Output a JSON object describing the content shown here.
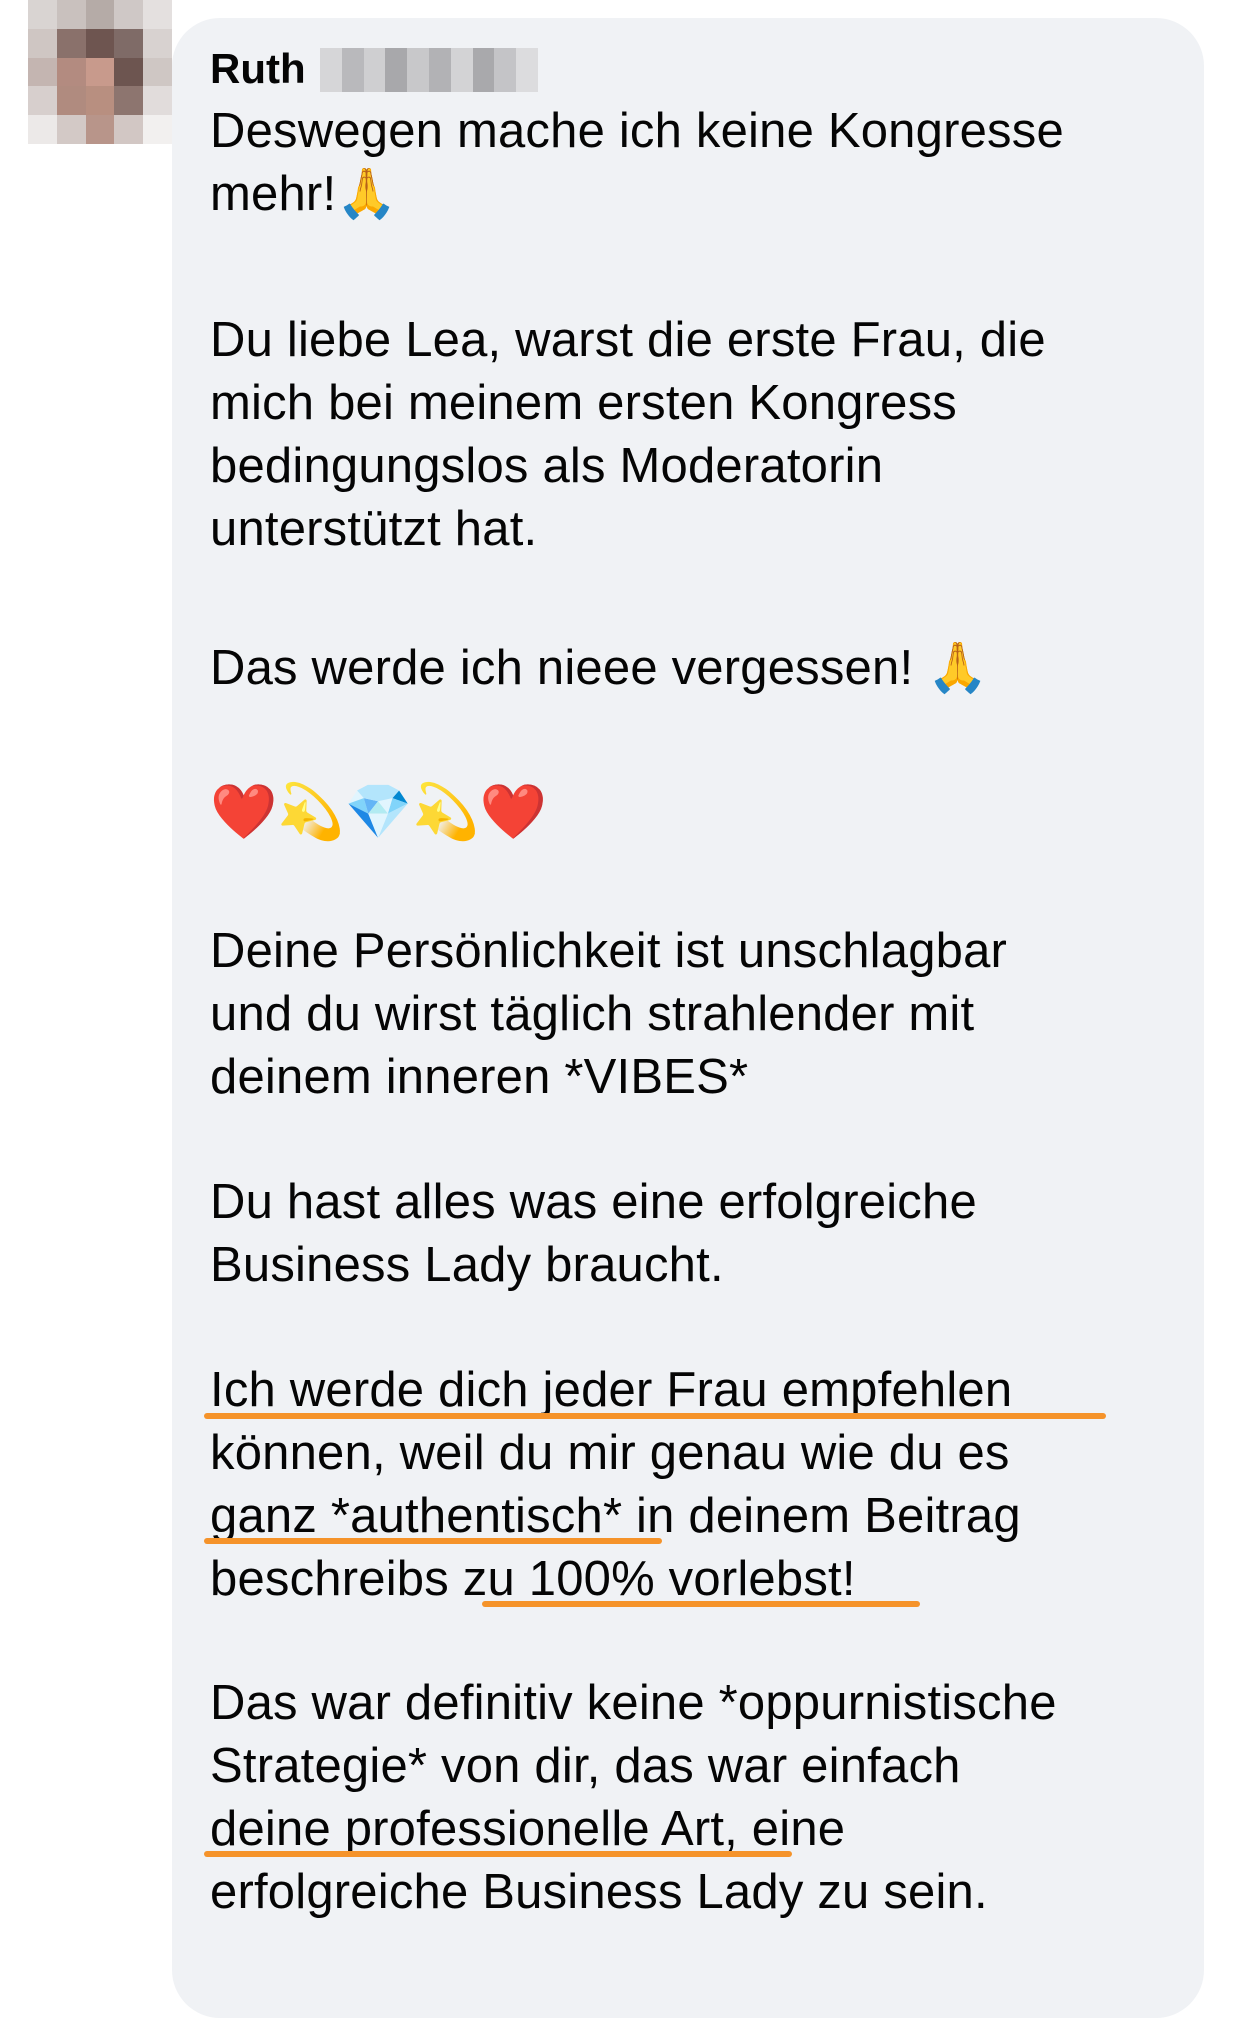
{
  "comment": {
    "author_first_name": "Ruth",
    "author_last_name_redacted": true,
    "lines": [
      "Deswegen mache ich keine Kongresse",
      "mehr!🙏",
      "Du liebe Lea,  warst die erste Frau, die",
      "mich bei meinem ersten Kongress",
      "bedingungslos als Moderatorin",
      "unterstützt hat.",
      "Das werde ich nieee vergessen! 🙏",
      "❤️💫💎💫❤️",
      "Deine Persönlichkeit ist unschlagbar",
      "und du wirst täglich strahlender mit",
      "deinem inneren *VIBES*",
      "Du hast alles was eine erfolgreiche",
      "Business Lady braucht.",
      "Ich werde dich jeder Frau empfehlen",
      "können, weil du mir genau wie du es",
      "ganz *authentisch* in deinem Beitrag",
      "beschreibs zu 100% vorlebst!",
      "Das war definitiv keine *oppurnistische",
      "Strategie* von dir, das war einfach",
      "deine professionelle Art, eine",
      "erfolgreiche Business Lady zu sein."
    ]
  },
  "colors": {
    "bubble_background": "#f0f2f5",
    "text": "#050505",
    "highlight_underline": "#f5932a"
  }
}
